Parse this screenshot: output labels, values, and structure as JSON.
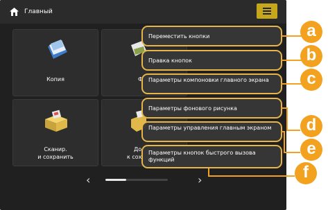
{
  "header": {
    "title": "Главный",
    "home_icon": "home-icon",
    "menu_icon": "hamburger-menu-icon"
  },
  "tiles": [
    {
      "label": "Копия",
      "icon": "copy-icon"
    },
    {
      "label": "Ф",
      "icon": "fax-icon"
    },
    {
      "label": "Сканир.\nи сохранить",
      "icon": "scan-and-store-icon"
    },
    {
      "label": "До\nк сох",
      "icon": "access-stored-files-icon"
    }
  ],
  "menu": [
    {
      "label": "Переместить кнопки",
      "badge": "a"
    },
    {
      "label": "Правка кнопок",
      "badge": "b"
    },
    {
      "label": "Параметры компоновки главного экрана",
      "badge": "c"
    },
    {
      "label": "Параметры фонового рисунка",
      "badge": "d"
    },
    {
      "label": "Параметры управления главным экраном",
      "badge": "e"
    },
    {
      "label": "Параметры кнопок быстрого вызова функций",
      "badge": "f"
    }
  ],
  "pager": {
    "prev": "‹",
    "next": "›",
    "position": 0.33
  },
  "colors": {
    "accent": "#e7b548",
    "badge": "#f2a21f",
    "menu_button": "#c6a71c",
    "screen_bg": "#202020"
  }
}
